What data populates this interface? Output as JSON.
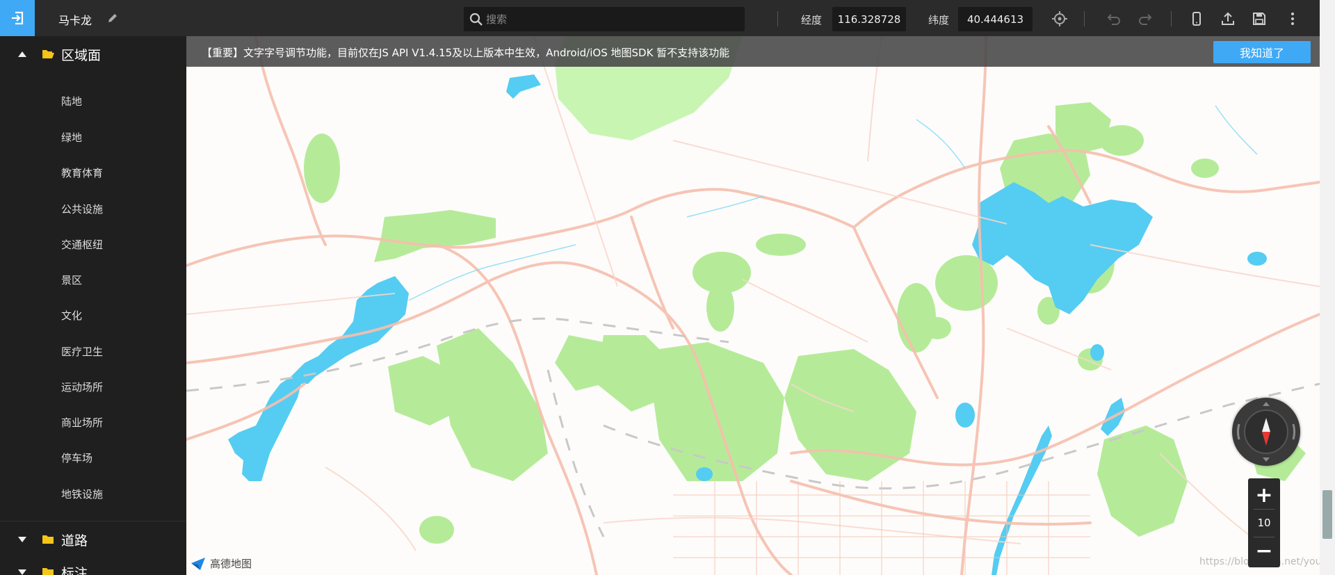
{
  "header": {
    "title": "马卡龙",
    "search_placeholder": "搜索",
    "longitude_label": "经度",
    "longitude_value": "116.328728",
    "latitude_label": "纬度",
    "latitude_value": "40.444613"
  },
  "sidebar": {
    "groups": [
      {
        "label": "区域面",
        "expanded": true,
        "items": [
          "陆地",
          "绿地",
          "教育体育",
          "公共设施",
          "交通枢纽",
          "景区",
          "文化",
          "医疗卫生",
          "运动场所",
          "商业场所",
          "停车场",
          "地铁设施"
        ]
      },
      {
        "label": "道路",
        "expanded": false
      },
      {
        "label": "标注",
        "expanded": false
      }
    ]
  },
  "notice": {
    "text": "【重要】文字字号调节功能，目前仅在JS API V1.4.15及以上版本中生效，Android/iOS 地图SDK 暂不支持该功能",
    "button": "我知道了"
  },
  "map": {
    "zoom_level": "10",
    "zoom_in": "+",
    "zoom_out": "−",
    "brand": "高德地图",
    "watermark": "https://blog.csdn.net/you"
  },
  "colors": {
    "accent": "#3fa9f5",
    "topbar": "#2b2b2b",
    "sidebar": "#1f1f1f",
    "park": "#b5eb98",
    "water": "#55ccf2",
    "road": "#f6bfae"
  },
  "icons": [
    "exit-icon",
    "pencil-icon",
    "search-icon",
    "locate-icon",
    "undo-icon",
    "redo-icon",
    "phone-icon",
    "upload-icon",
    "save-icon",
    "more-icon",
    "folder-icon",
    "compass-icon"
  ]
}
